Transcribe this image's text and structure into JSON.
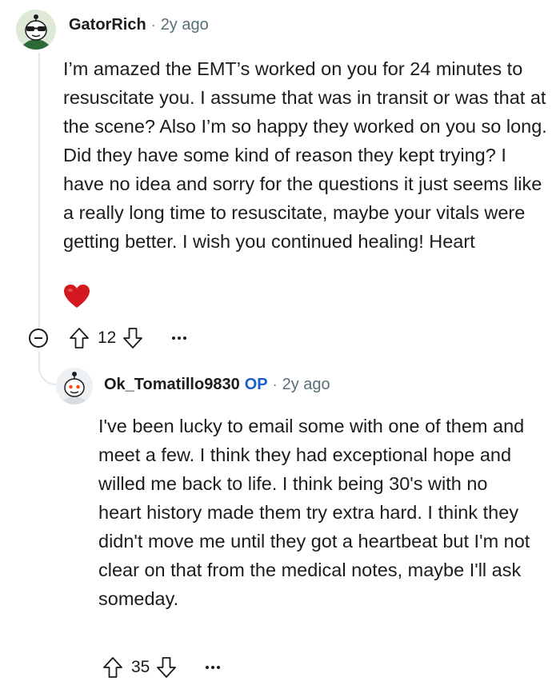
{
  "comment": {
    "username": "GatorRich",
    "separator": "·",
    "time": "2y ago",
    "body": "I’m amazed the EMT’s worked on you for 24 minutes to resuscitate you. I assume that was in transit or was that at the scene? Also I’m so happy they worked on you so long. Did they have some kind of reason they kept trying? I have no idea and sorry for the questions it just seems like a really long time to resuscitate, maybe your vitals were getting better. I wish you continued healing! Heart",
    "emoji": "heart-emoji",
    "vote_count": "12",
    "icons": [
      "collapse-icon",
      "upvote-icon",
      "downvote-icon",
      "more-icon"
    ]
  },
  "reply": {
    "username": "Ok_Tomatillo9830",
    "badge": "OP",
    "separator": "·",
    "time": "2y ago",
    "body": "I've been lucky to email some with one of them and meet a few. I think they had exceptional hope and willed me back to life. I think being 30's with no heart history made them try extra hard. I think they didn't move me until they got a heartbeat but I'm not clear on that from the medical notes, maybe I'll ask someday.",
    "vote_count": "35",
    "icons": [
      "upvote-icon",
      "downvote-icon",
      "more-icon"
    ]
  },
  "colors": {
    "op_badge": "#1a5fcb",
    "heart": "#d3181f",
    "meta_gray": "#576f76",
    "thread_line": "#e5e7eb"
  }
}
